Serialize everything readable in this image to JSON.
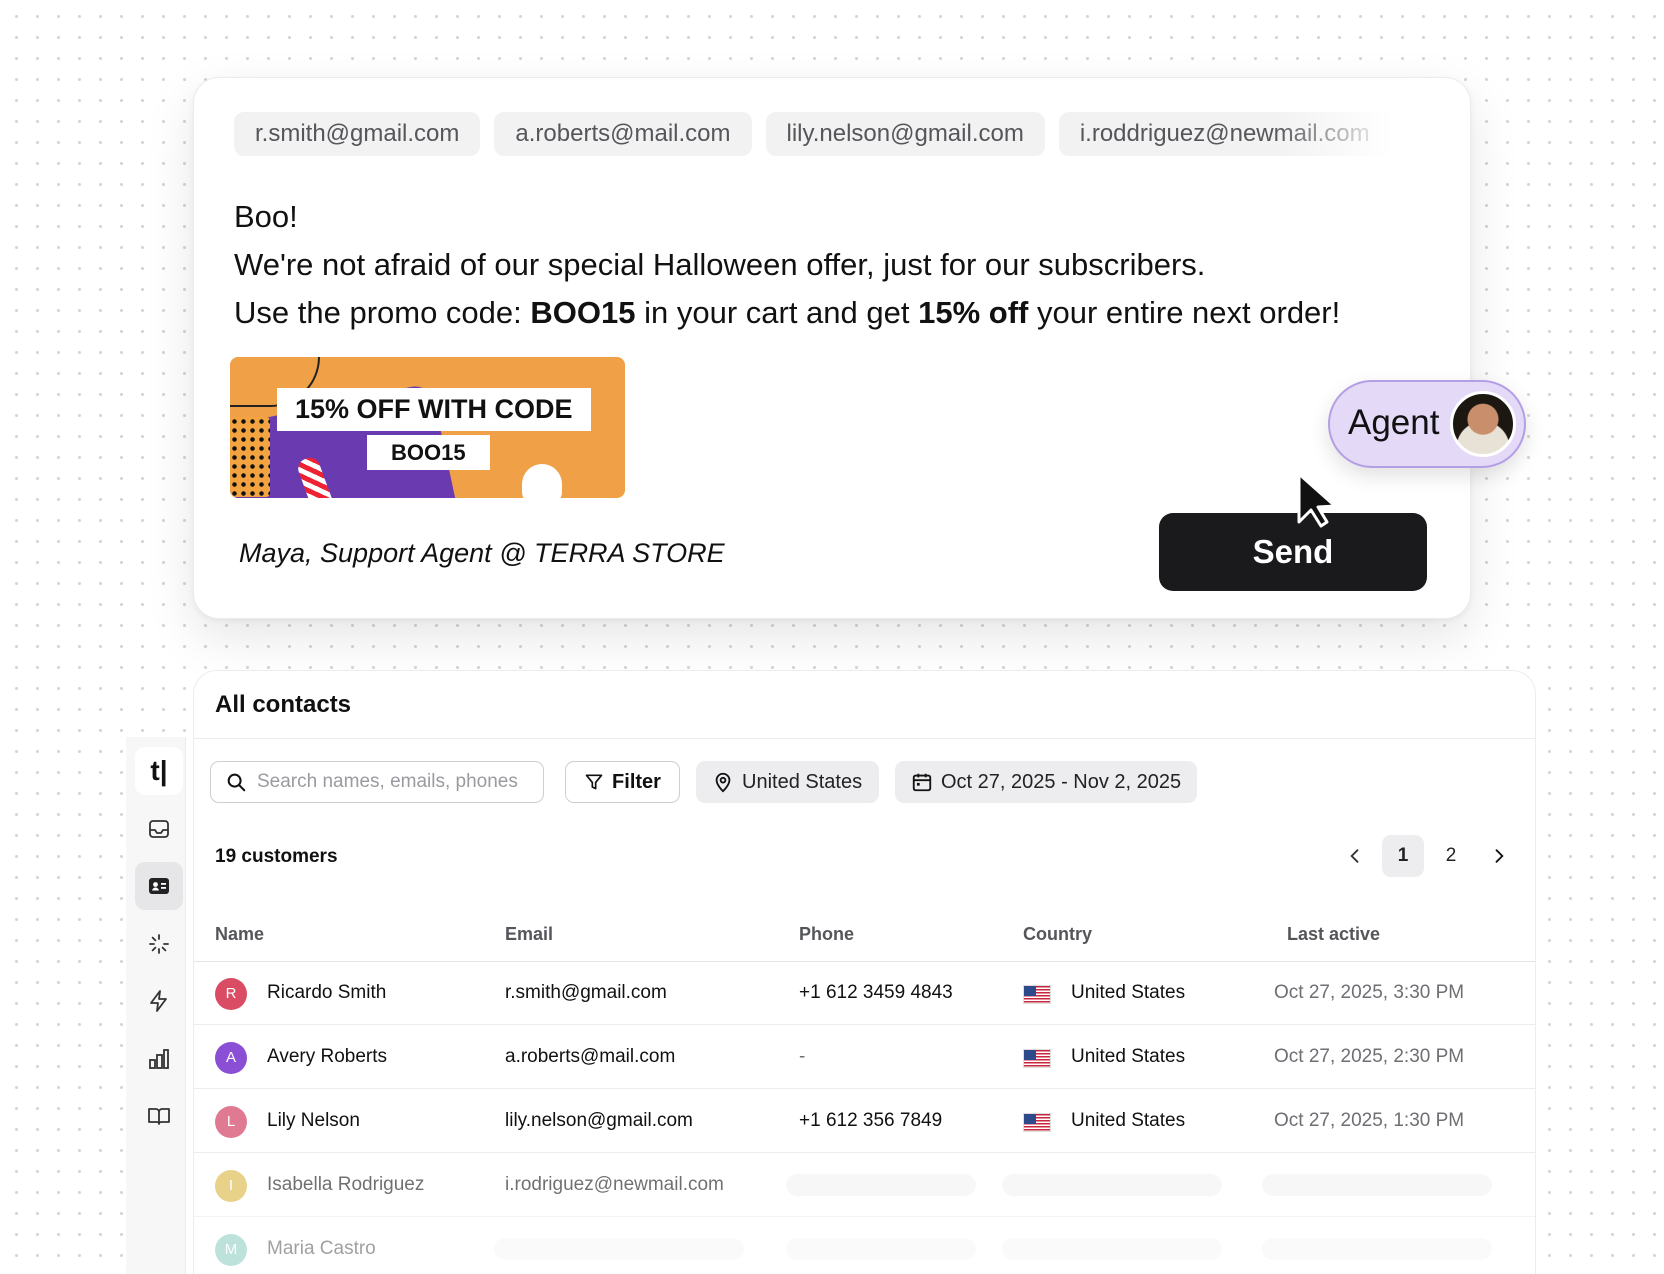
{
  "composer": {
    "recipients": [
      "r.smith@gmail.com",
      "a.roberts@mail.com",
      "lily.nelson@gmail.com",
      "i.roddriguez@newmail.com"
    ],
    "greeting": "Boo!",
    "line2": "We're not afraid of our special Halloween offer, just for our subscribers.",
    "line3_prefix": "Use the promo code: ",
    "promo_code": "BOO15",
    "line3_middle": " in your cart and get ",
    "discount": "15% off",
    "line3_suffix": " your entire next order!",
    "banner_line1": "15% OFF WITH CODE",
    "banner_line2": "BOO15",
    "signature": "Maya, Support Agent @ TERRA STORE",
    "send_label": "Send",
    "agent_label": "Agent"
  },
  "rail": {
    "logo": "t|",
    "icons": [
      "inbox-icon",
      "contacts-icon",
      "sparkle-icon",
      "bolt-icon",
      "chart-icon",
      "book-icon"
    ],
    "active": "contacts-icon"
  },
  "contacts": {
    "title": "All contacts",
    "search_placeholder": "Search names, emails, phones",
    "filter_label": "Filter",
    "country_filter": "United States",
    "date_range": "Oct 27, 2025 - Nov 2, 2025",
    "count_label": "19 customers",
    "pages": [
      "1",
      "2"
    ],
    "current_page": "1",
    "columns": [
      "Name",
      "Email",
      "Phone",
      "Country",
      "Last active"
    ],
    "rows": [
      {
        "initial": "R",
        "name": "Ricardo Smith",
        "email": "r.smith@gmail.com",
        "phone": "+1 612 3459 4843",
        "country": "United States",
        "last_active": "Oct 27, 2025, 3:30 PM",
        "color": "#d94c64"
      },
      {
        "initial": "A",
        "name": "Avery Roberts",
        "email": "a.roberts@mail.com",
        "phone": "-",
        "country": "United States",
        "last_active": "Oct 27, 2025, 2:30 PM",
        "color": "#8b4fd6"
      },
      {
        "initial": "L",
        "name": "Lily Nelson",
        "email": "lily.nelson@gmail.com",
        "phone": "+1 612 356 7849",
        "country": "United States",
        "last_active": "Oct 27, 2025, 1:30 PM",
        "color": "#e07a92"
      },
      {
        "initial": "I",
        "name": "Isabella Rodriguez",
        "email": "i.rodriguez@newmail.com",
        "color": "#d9b43a"
      },
      {
        "initial": "M",
        "name": "Maria Castro",
        "color": "#5cb8a6"
      }
    ]
  }
}
